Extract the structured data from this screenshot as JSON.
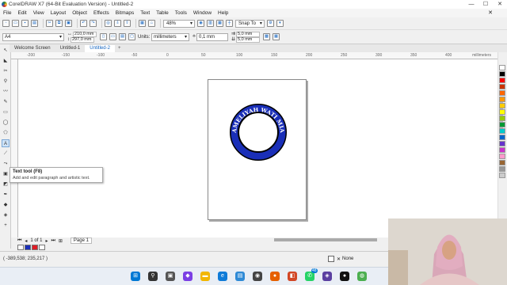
{
  "titlebar": {
    "title": "CorelDRAW X7 (64-Bit Evaluation Version) - Untitled-2",
    "minimize": "—",
    "maximize": "☐",
    "close": "✕"
  },
  "menu": {
    "items": [
      "File",
      "Edit",
      "View",
      "Layout",
      "Object",
      "Effects",
      "Bitmaps",
      "Text",
      "Table",
      "Tools",
      "Window",
      "Help"
    ],
    "close": "✕"
  },
  "toolbar": {
    "zoom": "48%",
    "snap": "Snap To"
  },
  "props": {
    "page_size": "A4",
    "width": "210,0 mm",
    "height": "297,0 mm",
    "units_label": "Units:",
    "units_value": "millimeters",
    "nudge": "0,1 mm",
    "dup_x": "5,0 mm",
    "dup_y": "5,0 mm"
  },
  "doc_tabs": [
    "Welcome Screen",
    "Untitled-1",
    "Untitled-2",
    "+"
  ],
  "ruler": {
    "ticks": [
      "-200",
      "-150",
      "-100",
      "-50",
      "0",
      "50",
      "100",
      "150",
      "200",
      "250",
      "300",
      "350",
      "400"
    ],
    "unit": "millimeters"
  },
  "artwork": {
    "circle_text": "AMELIYAH WATI MIA",
    "ring_color": "#1a2fb8",
    "outline_color": "#000000"
  },
  "tooltip": {
    "title": "Text tool (F8)",
    "desc": "Add and edit paragraph and artistic text."
  },
  "pagenav": {
    "page_count": "1 of 1",
    "page_tab": "Page 1"
  },
  "status": {
    "coords": "( -389,538; 235,217 )",
    "fill": "None"
  },
  "palette": [
    "#ffffff",
    "#000000",
    "#ff0000",
    "#cc3300",
    "#ff6600",
    "#ff9900",
    "#ffcc00",
    "#ffff00",
    "#99cc00",
    "#009933",
    "#00cccc",
    "#0066cc",
    "#6633cc",
    "#cc33cc",
    "#ff99cc",
    "#996633",
    "#999999",
    "#cccccc"
  ],
  "taskbar": {
    "badge": "48"
  }
}
